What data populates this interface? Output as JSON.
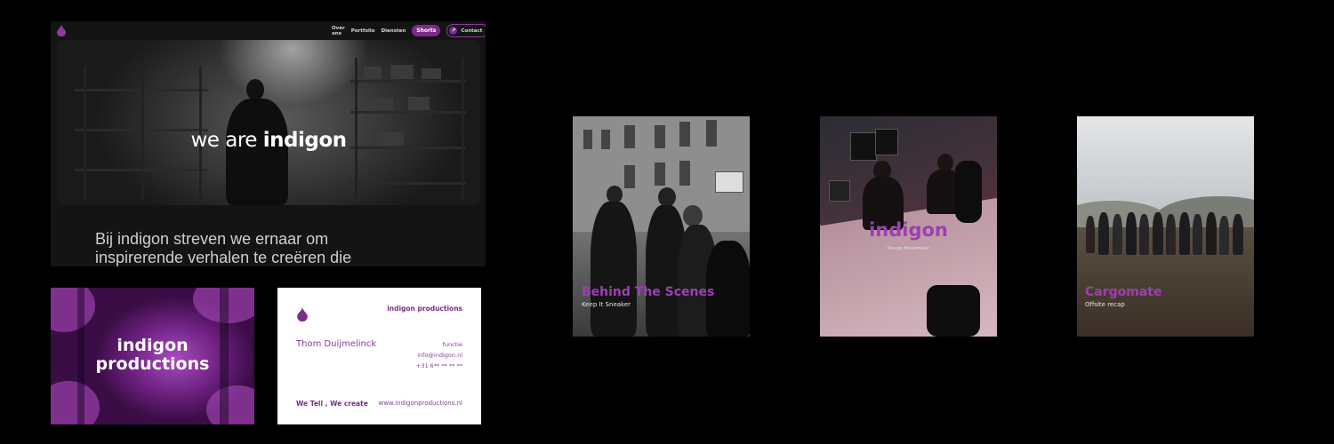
{
  "website": {
    "nav": {
      "items": [
        "Over ons",
        "Portfolio",
        "Diensten"
      ],
      "shorts_label": "Shorts",
      "contact_label": "Contact"
    },
    "hero": {
      "prefix": "we are",
      "brand": "indigon"
    },
    "mission_line1": "Bij indigon streven we ernaar om",
    "mission_line2": "inspirerende verhalen te creëren die"
  },
  "brand_card": {
    "line1": "indigon",
    "line2": "productions"
  },
  "business_card": {
    "company": "indigon productions",
    "name": "Thom Duijmelinck",
    "role": "functie",
    "email": "info@indigon.nl",
    "phone": "+31 6** ** ** **",
    "tagline": "We Tell , We create",
    "website": "www.indigonproductions.nl"
  },
  "posters": [
    {
      "title": "Behind The Scenes",
      "subtitle": "Keep It Sneaker"
    },
    {
      "title": "indigon",
      "subtitle": "Recap November"
    },
    {
      "title": "Cargomate",
      "subtitle": "Offsite recap"
    }
  ],
  "colors": {
    "accent": "#7a2c8a",
    "accent_light": "#9d3fb4",
    "background": "#000000"
  },
  "icons": [
    "drop-logo-icon",
    "arrow-up-right-icon"
  ]
}
